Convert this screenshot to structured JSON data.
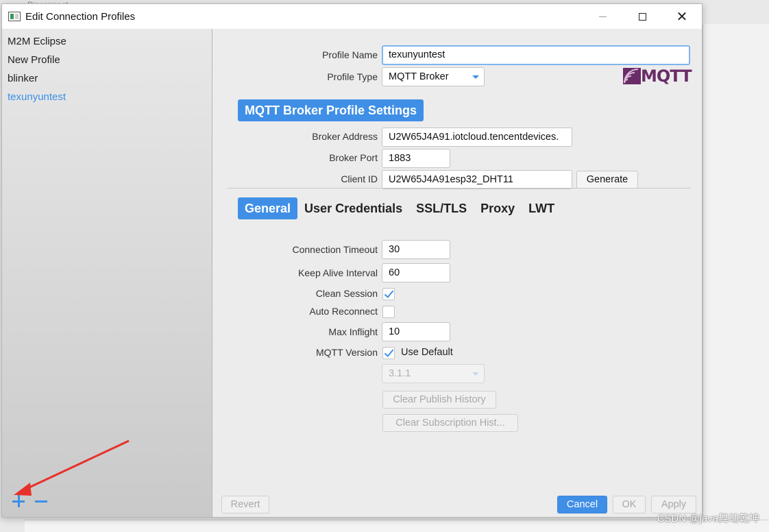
{
  "window": {
    "title": "Edit Connection Profiles"
  },
  "background_app": {
    "tab_label": "Disconnect"
  },
  "sidebar": {
    "profiles": [
      "M2M Eclipse",
      "New Profile",
      "blinker",
      "texunyuntest"
    ],
    "selected_index": 3
  },
  "form": {
    "profile_name_label": "Profile Name",
    "profile_name_value": "texunyuntest",
    "profile_type_label": "Profile Type",
    "profile_type_value": "MQTT Broker",
    "logo_text": "MQTT",
    "section_header": "MQTT Broker Profile Settings",
    "broker_address_label": "Broker Address",
    "broker_address_value": "U2W65J4A91.iotcloud.tencentdevices.",
    "broker_port_label": "Broker Port",
    "broker_port_value": "1883",
    "client_id_label": "Client ID",
    "client_id_value": "U2W65J4A91esp32_DHT11",
    "generate_button": "Generate"
  },
  "tabs": [
    "General",
    "User Credentials",
    "SSL/TLS",
    "Proxy",
    "LWT"
  ],
  "active_tab": "General",
  "general": {
    "connection_timeout_label": "Connection Timeout",
    "connection_timeout_value": "30",
    "keep_alive_label": "Keep Alive Interval",
    "keep_alive_value": "60",
    "clean_session_label": "Clean Session",
    "clean_session_checked": true,
    "auto_reconnect_label": "Auto Reconnect",
    "auto_reconnect_checked": false,
    "max_inflight_label": "Max Inflight",
    "max_inflight_value": "10",
    "mqtt_version_label": "MQTT Version",
    "use_default_label": "Use Default",
    "use_default_checked": true,
    "version_value": "3.1.1",
    "clear_publish_button": "Clear Publish History",
    "clear_subscription_button": "Clear Subscription Hist..."
  },
  "footer": {
    "revert_button": "Revert",
    "cancel_button": "Cancel",
    "ok_button": "OK",
    "apply_button": "Apply"
  },
  "watermark": "CSDN @java舞动乾坤",
  "colors": {
    "accent": "#3f8fe6",
    "arrow": "#e8302a",
    "logo": "#6a2c68"
  }
}
